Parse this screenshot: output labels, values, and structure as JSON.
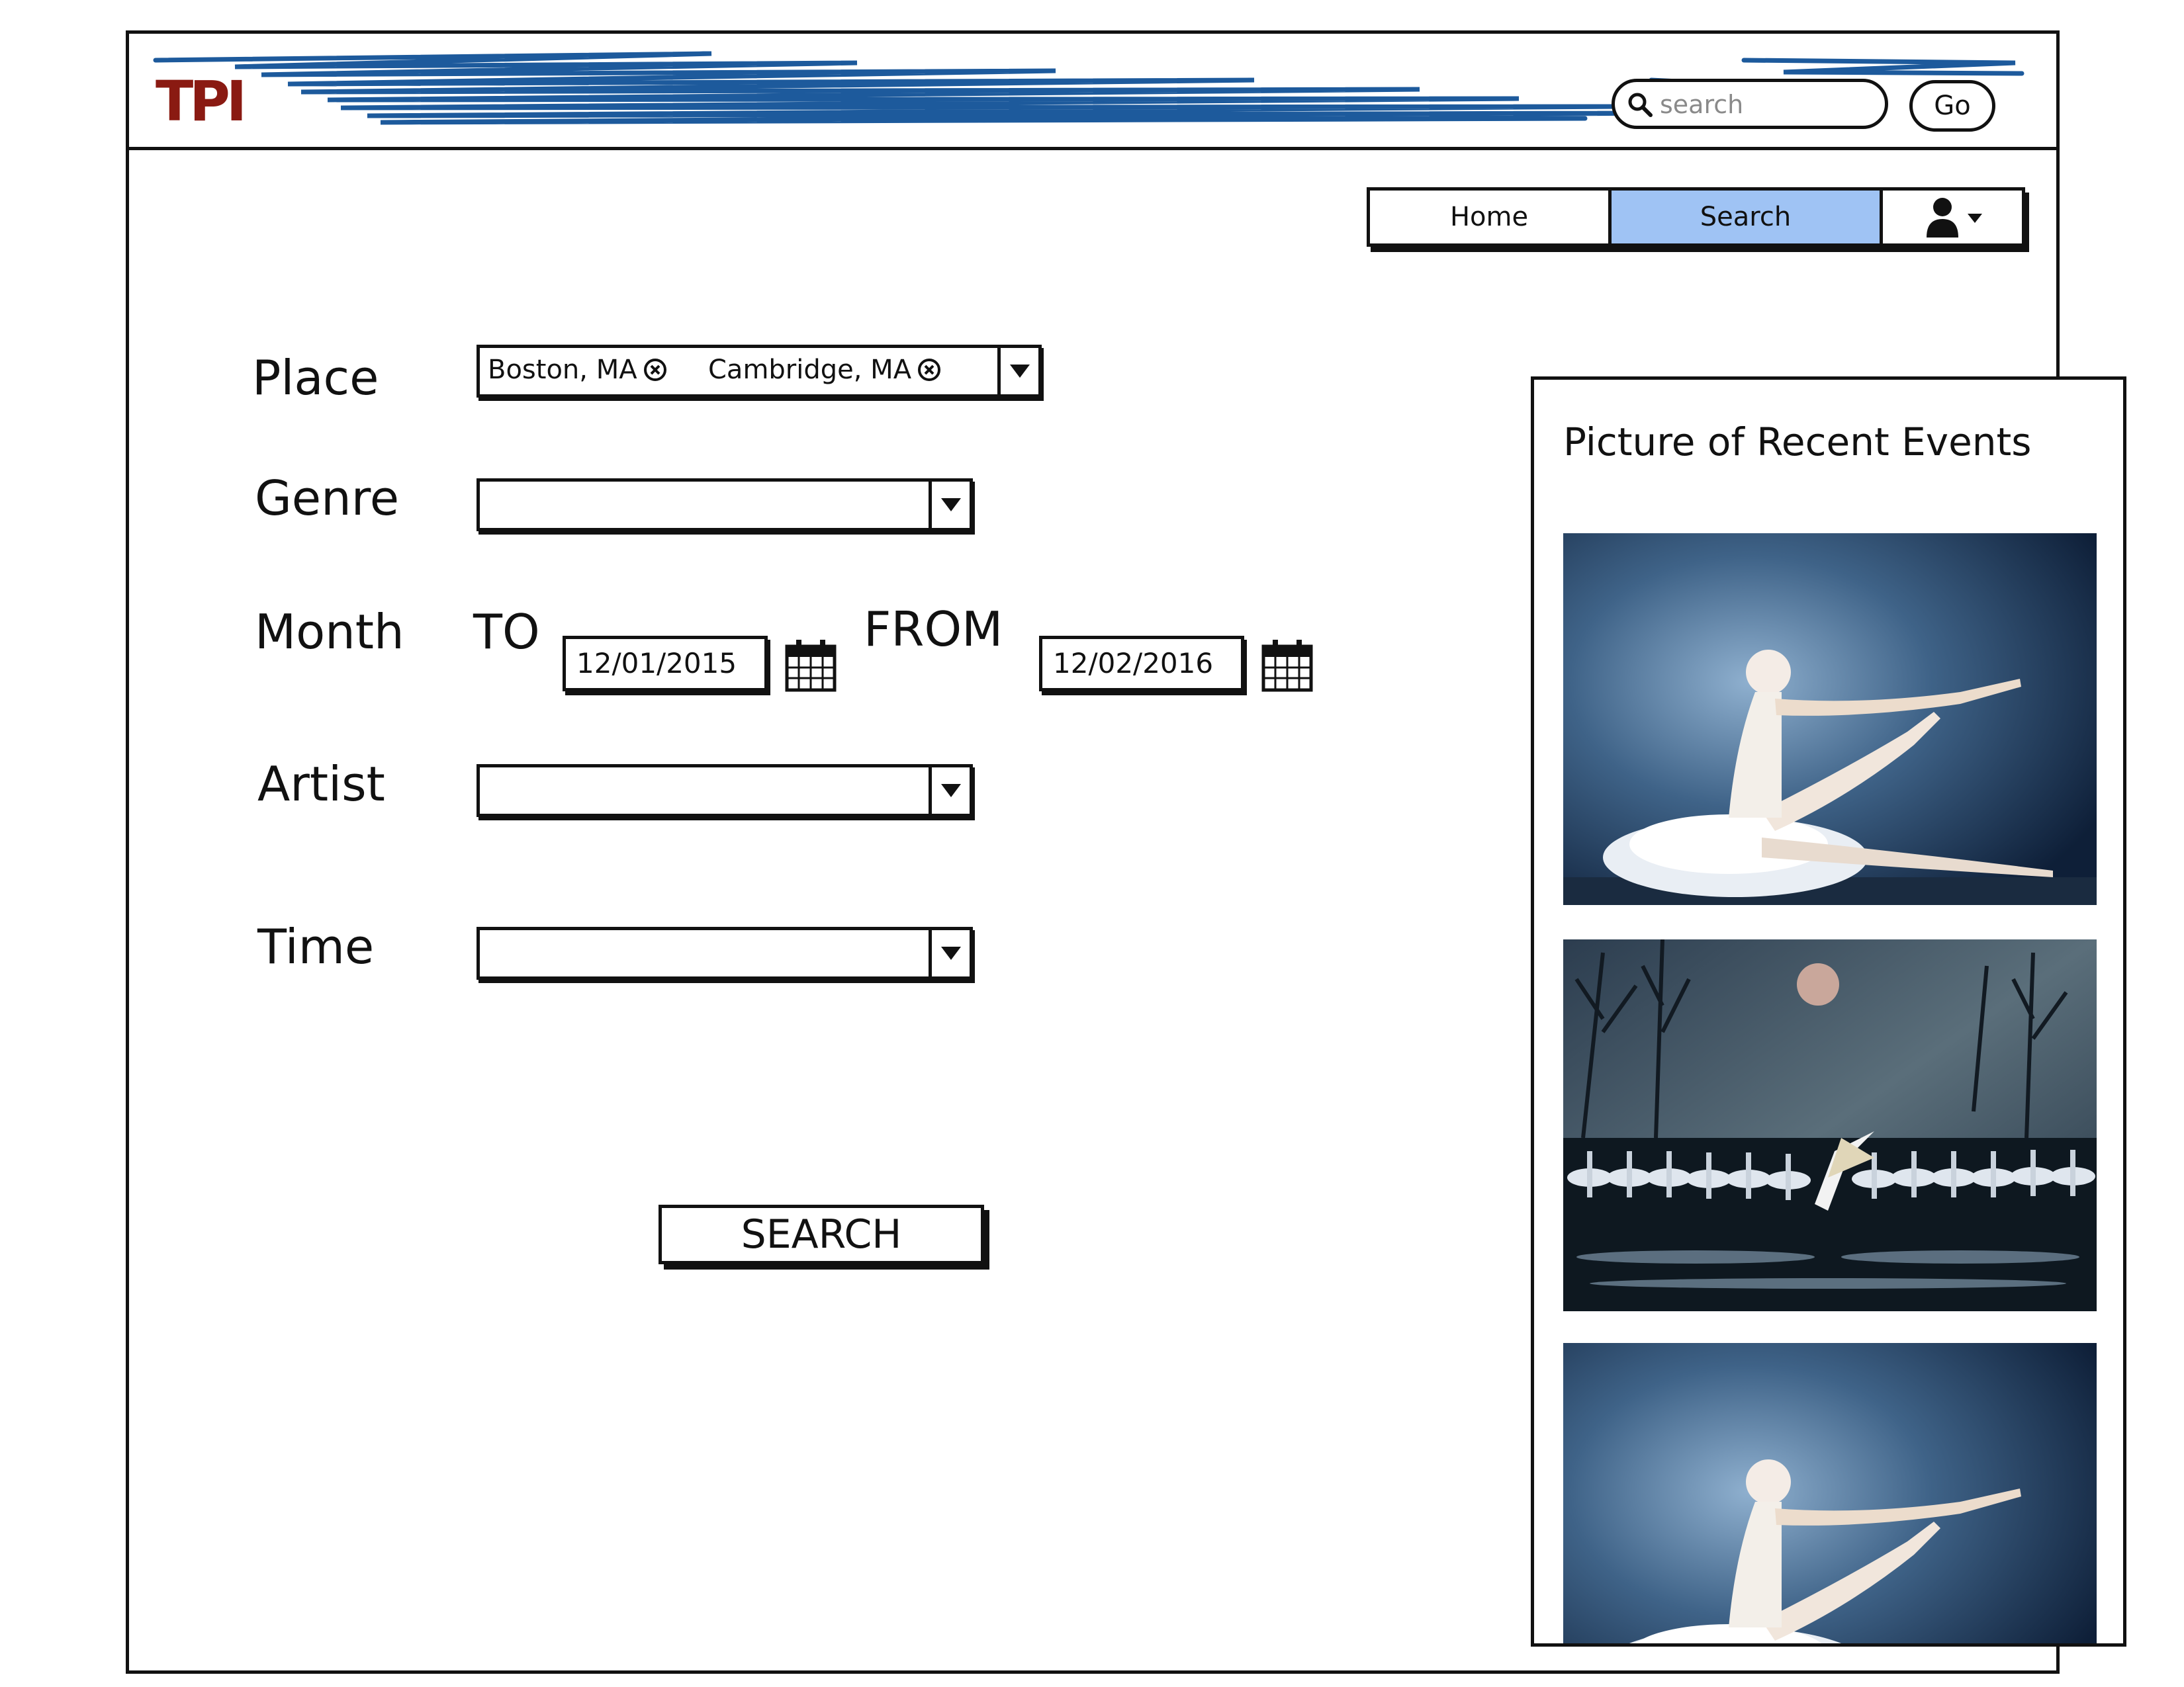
{
  "header": {
    "logo_text": "TPI",
    "search_placeholder": "search",
    "go_label": "Go"
  },
  "nav": {
    "home": "Home",
    "search": "Search",
    "user_icon": "user-icon"
  },
  "form": {
    "place_label": "Place",
    "place_tags": [
      "Boston, MA",
      "Cambridge, MA"
    ],
    "genre_label": "Genre",
    "genre_value": "",
    "month_label": "Month",
    "to_label": "TO",
    "to_date": "12/01/2015",
    "from_label": "FROM",
    "from_date": "12/02/2016",
    "artist_label": "Artist",
    "artist_value": "",
    "time_label": "Time",
    "time_value": "",
    "search_button": "SEARCH"
  },
  "panel": {
    "title": "Picture of Recent Events",
    "images": [
      "ballerina-solo-photo",
      "swan-lake-corps-photo",
      "ballerina-solo-photo"
    ]
  },
  "colors": {
    "logo": "#8a1a12",
    "banner_stroke": "#1d5a9c",
    "nav_active": "#9fc3f4"
  }
}
